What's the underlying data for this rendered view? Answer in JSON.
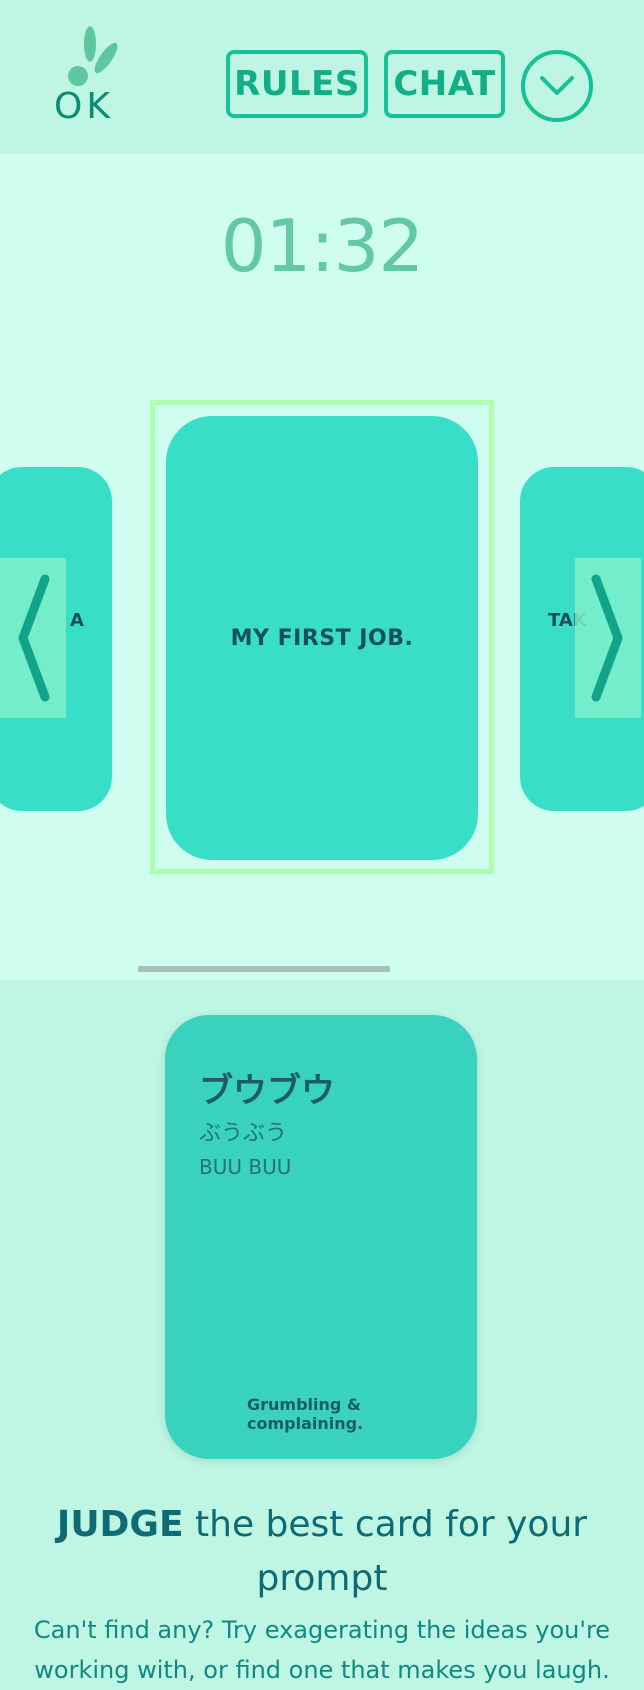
{
  "header": {
    "logo_text": "OK",
    "rules_label": "RULES",
    "chat_label": "CHAT",
    "menu_icon": "chevron-down-icon"
  },
  "colors": {
    "accent": "#16c196",
    "card": "#38dfc6",
    "selected_outline": "#aefdb0",
    "header_bg": "#bef5e3",
    "stage_bg": "#cffef0"
  },
  "timer": {
    "value": "01:32"
  },
  "carousel": {
    "prev_card_text": "A",
    "current_card_text": "MY FIRST JOB.",
    "next_card_text": "TAK"
  },
  "hand_card": {
    "japanese": "ブウブウ",
    "kana": "ぶうぶう",
    "romaji": "BUU BUU",
    "meaning": "Grumbling & complaining."
  },
  "instructions": {
    "headline_bold": "JUDGE",
    "headline_rest": " the best card for your prompt",
    "subtext_line1": "Can't find any? Try exagerating the ideas you're",
    "subtext_line2": "working with, or find one that makes you laugh."
  }
}
